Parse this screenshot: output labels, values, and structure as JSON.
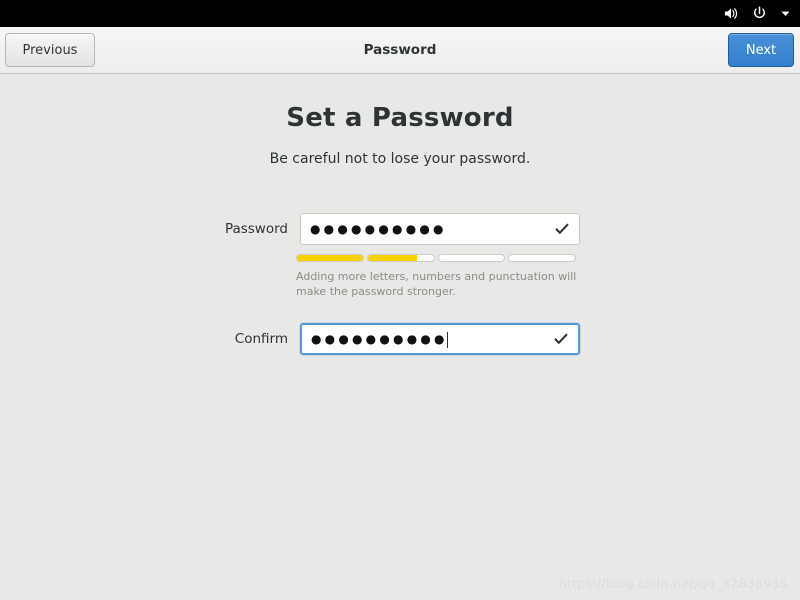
{
  "system_bar": {
    "icons": [
      {
        "name": "volume-icon",
        "label": "Volume"
      },
      {
        "name": "power-icon",
        "label": "Power"
      },
      {
        "name": "chevron-down-icon",
        "label": "System menu"
      }
    ],
    "background_color": "#000000"
  },
  "toolbar": {
    "title": "Password",
    "previous_label": "Previous",
    "next_label": "Next",
    "next_color": "#4a90d9"
  },
  "main": {
    "heading": "Set a Password",
    "subheading": "Be careful not to lose your password.",
    "fields": [
      {
        "label": "Password",
        "value": "●●●●●●●●●●",
        "char_count": 10,
        "focused": false,
        "valid_icon": "check-icon"
      },
      {
        "label": "Confirm",
        "value": "●●●●●●●●●●",
        "char_count": 10,
        "focused": true,
        "valid_icon": "check-icon"
      }
    ],
    "strength_meter": {
      "segments": 4,
      "filled": [
        100,
        75,
        0,
        0
      ],
      "fill_color": "#f5d200",
      "empty_color": "#ffffff"
    },
    "hint": "Adding more letters, numbers and punctuation will make the password stronger."
  },
  "watermark": {
    "text": "https://blog.csdn.net/qq_32838955"
  }
}
